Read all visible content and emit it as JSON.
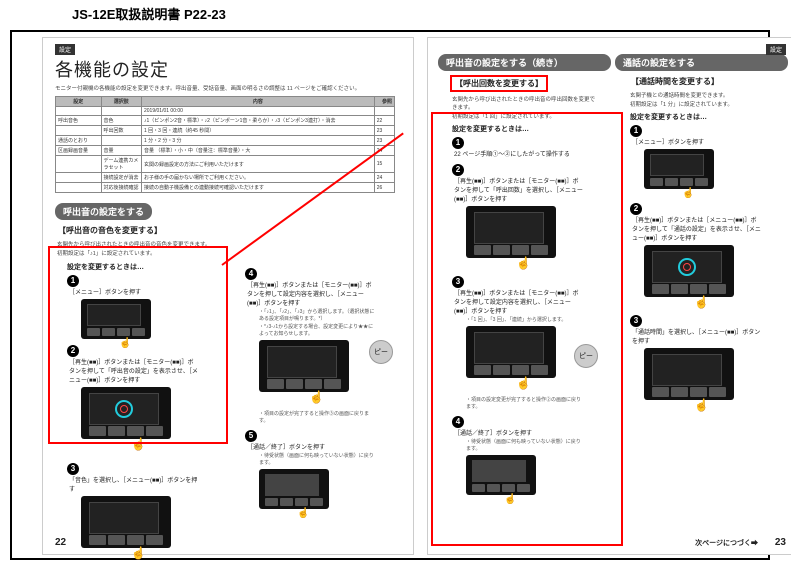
{
  "doc_title": "JS-12E取扱説明書 P22-23",
  "left": {
    "tab": "設定",
    "heading": "各機能の設定",
    "subheading": "モニター付親機の各機能の設定を変更できます。呼出音量、受話音量、画面の明るさの調整は 11 ページをご確認ください。",
    "table": {
      "head": [
        "設定",
        "選択肢",
        "内容",
        "参照"
      ],
      "rows": [
        [
          "",
          "",
          "2019/01/01 00:00",
          ""
        ],
        [
          "呼出音色",
          "音色",
          "♪1（ピンポン2音・標準）・♪2（ピンポーン1音・柔らか）・♪3（ピンポン3連打）・消去",
          "22"
        ],
        [
          "",
          "呼出回数",
          "1 回・3 回・連続（約45 秒間）",
          "23"
        ],
        [
          "通話のとおり",
          "",
          "1 分・2 分・3 分",
          "23"
        ],
        [
          "区画録画音量",
          "音量",
          "音量 （標準）・小・中（音量注：標準音量）・大",
          "24"
        ],
        [
          "",
          "デーム連携カメラセット",
          "玄関の録画設定の方法にご利用いただけます",
          "15"
        ],
        [
          "",
          "接続設定が消去",
          "お子様の手の届かない場所でご利用ください。",
          "24"
        ],
        [
          "",
          "対応後接続確認",
          "接続の自動子機設備との連動接続可確認いただけます",
          "26"
        ]
      ]
    },
    "section_bar": "呼出音の設定をする",
    "bracket": "【呼出音の音色を変更する】",
    "desc1": "玄関先から呼び出されたときの呼出音の音色を変更できます。",
    "desc2": "初期設定は「♪1」に設定されています。",
    "steps_title": "設定を変更するときは…",
    "s1": "［メニュー］ボタンを押す",
    "s2": "［再生(■■)］ボタンまたは［モニター(■■)］ボタンを押して「呼出音の設定」を表示させ、［メニュー(■■)］ボタンを押す",
    "s3": "「音色」を選択し、［メニュー(■■)］ボタンを押す",
    "s4": "［再生(■■)］ボタンまたは［モニター(■■)］ボタンを押して設定内容を選択し、［メニュー(■■)］ボタンを押す",
    "s4_note1": "・「♪1」、「♪2」、「♪3」から選択します。（選択状態にある設定項目が鳴ります。*）",
    "s4_note2": "・*♪3-♪1から設定する場合、設定変更により★★によってお知らせします。",
    "s4_note3": "・項目の設定が完了すると操作③の画面に戻ります。",
    "s5": "［通話／終了］ボタンを押す",
    "s5_note": "・待受状態（画面に何も映っていない状態）に戻ります。",
    "pee": "ピー",
    "pagenum": "22"
  },
  "right": {
    "tab": "設定",
    "bar_left": "呼出音の設定をする（続き）",
    "bar_right": "通話の設定をする",
    "colL": {
      "bracket": "【呼出回数を変更する】",
      "desc1": "玄関先から呼び出されたときの呼出音の呼出回数を変更できます。",
      "desc2": "初期設定は「1 回」に設定されています。",
      "steps_title": "設定を変更するときは…",
      "s1": "22 ページ手順①～②にしたがって操作する",
      "s2": "［再生(■■)］ボタンまたは［モニター(■■)］ボタンを押して「呼出回数」を選択し、［メニュー(■■)］ボタンを押す",
      "s3": "［再生(■■)］ボタンまたは［モニター(■■)］ボタンを押して設定内容を選択し、［メニュー(■■)］ボタンを押す",
      "s3_note1": "・「1 回」、「3 回」、「連続」から選択します。",
      "s3_note2": "・項目の設定変更が完了すると操作②の画面に戻ります。",
      "s4": "［通話／終了］ボタンを押す",
      "s4_note": "・待受状態（画面に何も映っていない状態）に戻ります。"
    },
    "colR": {
      "bracket": "【通話時間を変更する】",
      "desc1": "玄関子機との通話時間を変更できます。",
      "desc2": "初期設定は「1 分」に設定されています。",
      "steps_title": "設定を変更するときは…",
      "s1": "［メニュー］ボタンを押す",
      "s2": "［再生(■■)］ボタンまたは［メニュー(■■)］ボタンを押して「通話の設定」を表示させ、［メニュー(■■)］ボタンを押す",
      "s3": "「通話時間」を選択し、［メニュー(■■)］ボタンを押す"
    },
    "pee": "ピー",
    "cont": "次ページにつづく➡",
    "pagenum": "23"
  }
}
